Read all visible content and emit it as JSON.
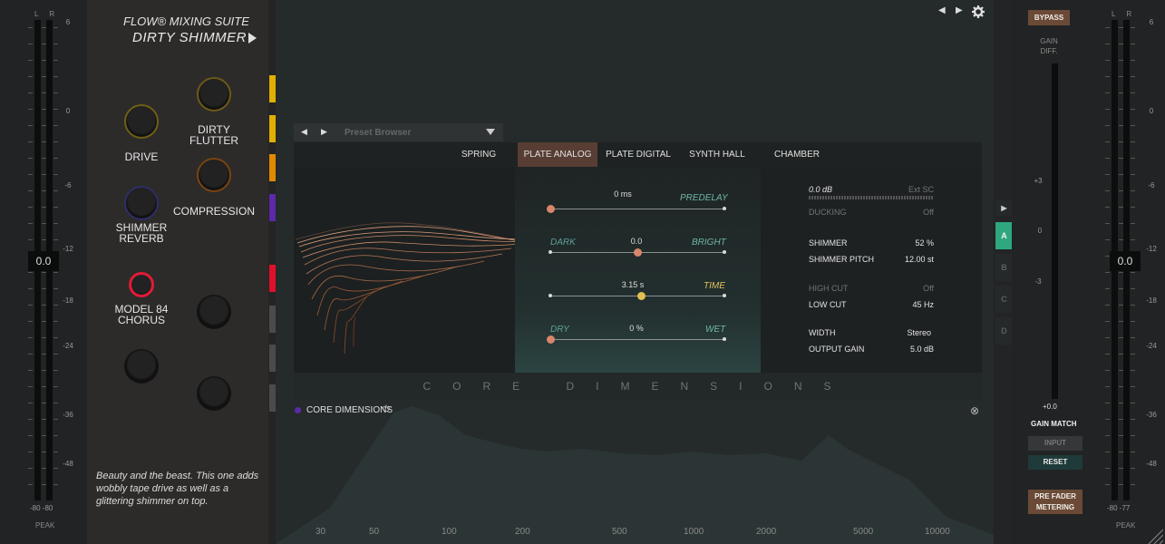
{
  "left_meter": {
    "lr_label": "L R",
    "scale": [
      "6",
      "0",
      "-6",
      "-12",
      "-18",
      "-24",
      "-36",
      "-48"
    ],
    "readout": "0.0",
    "peak_values": "-80  -80",
    "peak_label": "PEAK"
  },
  "right_meter": {
    "lr_label": "L R",
    "scale": [
      "6",
      "0",
      "-6",
      "-12",
      "-18",
      "-24",
      "-36",
      "-48"
    ],
    "readout": "0.0",
    "peak_values": "-80  -77",
    "peak_label": "PEAK"
  },
  "sidebar": {
    "suite": "FLOW® MIXING SUITE",
    "preset": "DIRTY SHIMMER",
    "knobs": [
      {
        "label": "DRIVE",
        "color": "#6e6018"
      },
      {
        "label": "DIRTY FLUTTER",
        "color": "#6e5a18"
      },
      {
        "label": "COMPRESSION",
        "color": "#7a4512"
      },
      {
        "label": "SHIMMER REVERB",
        "color": "#2e2f6a"
      },
      {
        "label": "MODEL 84 CHORUS",
        "color": "#e01c36"
      }
    ],
    "description": "Beauty and the beast. This one adds wobbly tape drive as well as a glittering shimmer on top."
  },
  "swatches": [
    "#e0b000",
    "#e0b000",
    "#e08a00",
    "#5a2aa8",
    "#e0102a",
    "#4a4b4c",
    "#4a4b4c",
    "#4a4b4c"
  ],
  "plugin": {
    "preset_browser": "Preset Browser",
    "tabs": [
      "SPRING",
      "PLATE ANALOG",
      "PLATE DIGITAL",
      "SYNTH HALL",
      "CHAMBER"
    ],
    "active_tab": "PLATE ANALOG",
    "sliders": {
      "predelay": {
        "label": "PREDELAY",
        "value": "0 ms",
        "position": 0.0
      },
      "tone": {
        "left_label": "DARK",
        "right_label": "BRIGHT",
        "value": "0.0",
        "position": 0.5
      },
      "time": {
        "label": "TIME",
        "value": "3.15 s",
        "position": 0.5
      },
      "mix": {
        "left_label": "DRY",
        "right_label": "WET",
        "value": "0 %",
        "position": 0.0
      }
    },
    "settings": {
      "gain_db": "0.0 dB",
      "ext_sc": "Ext SC",
      "ducking_label": "DUCKING",
      "ducking_value": "Off",
      "shimmer_label": "SHIMMER",
      "shimmer_value": "52 %",
      "pitch_label": "SHIMMER PITCH",
      "pitch_value": "12.00 st",
      "highcut_label": "HIGH CUT",
      "highcut_value": "Off",
      "lowcut_label": "LOW CUT",
      "lowcut_value": "45 Hz",
      "width_label": "WIDTH",
      "width_value": "Stereo",
      "output_label": "OUTPUT GAIN",
      "output_value": "5.0 dB"
    },
    "footer": "CORE DIMENSIONS"
  },
  "module_label": "CORE DIMENSIONS",
  "ab_slots": [
    "A",
    "B",
    "C",
    "D"
  ],
  "freq_labels": [
    "30",
    "50",
    "100",
    "200",
    "500",
    "1000",
    "2000",
    "5000",
    "10000"
  ],
  "right_panel": {
    "bypass": "BYPASS",
    "gain_diff": "GAIN\nDIFF.",
    "scale": [
      "+3",
      "0",
      "-3"
    ],
    "gd_value": "+0.0",
    "gain_match": "GAIN MATCH",
    "input": "INPUT",
    "reset": "RESET",
    "pre_fader": "PRE FADER\nMETERING"
  }
}
